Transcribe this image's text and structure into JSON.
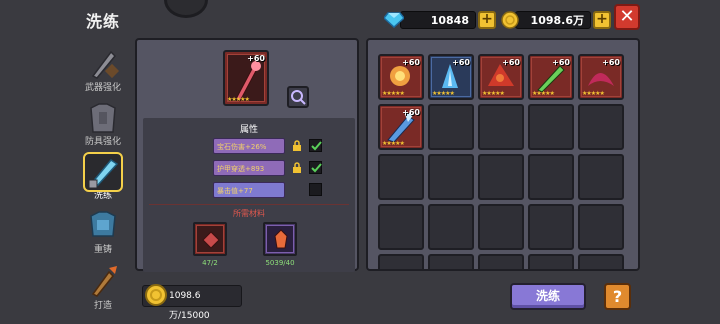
{
  "header": {
    "title": "洗练"
  },
  "currency": {
    "gems": {
      "value": "10848",
      "icon": "gem-icon"
    },
    "coins": {
      "value": "1098.6万",
      "icon": "coin-icon"
    }
  },
  "sidebar": {
    "items": [
      {
        "label": "武器强化",
        "icon": "weapon-icon",
        "active": false
      },
      {
        "label": "防具强化",
        "icon": "armor-icon",
        "active": false
      },
      {
        "label": "洗练",
        "icon": "sword-icon",
        "active": true
      },
      {
        "label": "重铸",
        "icon": "recast-icon",
        "active": false
      },
      {
        "label": "打造",
        "icon": "forge-icon",
        "active": false
      }
    ]
  },
  "selected_item": {
    "level": "+60",
    "stars": "★★★★★"
  },
  "attributes": {
    "title": "属性",
    "rows": [
      {
        "text": "宝石伤害+26%",
        "locked": true,
        "checked": true
      },
      {
        "text": "护甲穿透+893",
        "locked": true,
        "checked": true
      },
      {
        "text": "暴击值+77",
        "locked": false,
        "checked": false
      }
    ]
  },
  "materials": {
    "title": "所需材料",
    "items": [
      {
        "count": "47/2",
        "color": "red"
      },
      {
        "count": "5039/40",
        "color": "purple"
      }
    ]
  },
  "cost": {
    "value": "1098.6万/15000"
  },
  "inventory": {
    "items": [
      {
        "level": "+60",
        "stars": "★★★★★"
      },
      {
        "level": "+60",
        "stars": "★★★★★"
      },
      {
        "level": "+60",
        "stars": "★★★★★"
      },
      {
        "level": "+60",
        "stars": "★★★★★"
      },
      {
        "level": "+60",
        "stars": "★★★★★"
      },
      {
        "level": "+60",
        "stars": "★★★★★"
      }
    ]
  },
  "actions": {
    "wash_label": "洗练",
    "help_label": "?"
  },
  "colors": {
    "accent": "#8878d6",
    "gold": "#f1c232",
    "close": "#d23a2e",
    "help": "#e08a2e"
  }
}
